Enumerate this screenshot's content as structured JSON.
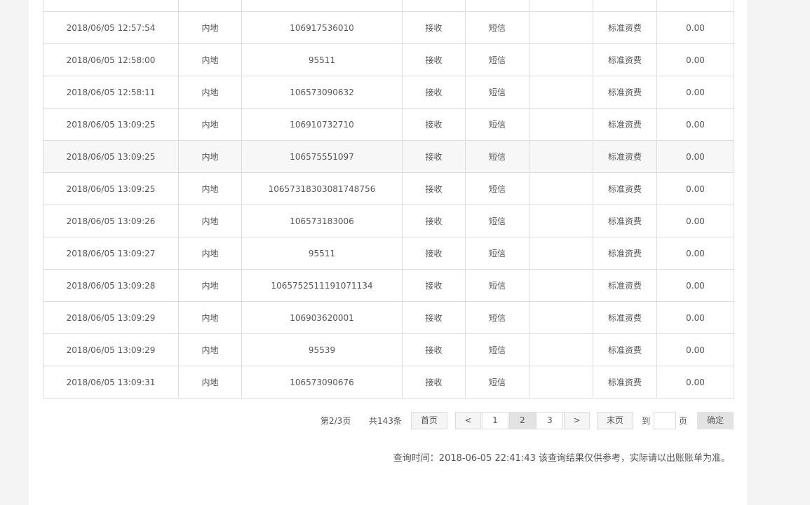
{
  "table": {
    "rows": [
      [
        "",
        "",
        "",
        "",
        "",
        "",
        "",
        ""
      ],
      [
        "2018/06/05 12:57:54",
        "内地",
        "106917536010",
        "接收",
        "短信",
        "",
        "标准资费",
        "0.00"
      ],
      [
        "2018/06/05 12:58:00",
        "内地",
        "95511",
        "接收",
        "短信",
        "",
        "标准资费",
        "0.00"
      ],
      [
        "2018/06/05 12:58:11",
        "内地",
        "106573090632",
        "接收",
        "短信",
        "",
        "标准资费",
        "0.00"
      ],
      [
        "2018/06/05 13:09:25",
        "内地",
        "106910732710",
        "接收",
        "短信",
        "",
        "标准资费",
        "0.00"
      ],
      [
        "2018/06/05 13:09:25",
        "内地",
        "106575551097",
        "接收",
        "短信",
        "",
        "标准资费",
        "0.00"
      ],
      [
        "2018/06/05 13:09:25",
        "内地",
        "10657318303081748756",
        "接收",
        "短信",
        "",
        "标准资费",
        "0.00"
      ],
      [
        "2018/06/05 13:09:26",
        "内地",
        "106573183006",
        "接收",
        "短信",
        "",
        "标准资费",
        "0.00"
      ],
      [
        "2018/06/05 13:09:27",
        "内地",
        "95511",
        "接收",
        "短信",
        "",
        "标准资费",
        "0.00"
      ],
      [
        "2018/06/05 13:09:28",
        "内地",
        "1065752511191071134",
        "接收",
        "短信",
        "",
        "标准资费",
        "0.00"
      ],
      [
        "2018/06/05 13:09:29",
        "内地",
        "106903620001",
        "接收",
        "短信",
        "",
        "标准资费",
        "0.00"
      ],
      [
        "2018/06/05 13:09:29",
        "内地",
        "95539",
        "接收",
        "短信",
        "",
        "标准资费",
        "0.00"
      ],
      [
        "2018/06/05 13:09:31",
        "内地",
        "106573090676",
        "接收",
        "短信",
        "",
        "标准资费",
        "0.00"
      ]
    ],
    "highlighted_row": 5
  },
  "pagination": {
    "page_info": "第2/3页",
    "total_info": "共143条",
    "first_label": "首页",
    "prev_label": "<",
    "pages": [
      "1",
      "2",
      "3"
    ],
    "current_page": "2",
    "next_label": ">",
    "last_label": "末页",
    "goto_prefix": "到",
    "goto_value": "",
    "goto_suffix": "页",
    "confirm_label": "确定"
  },
  "query_note": "查询时间：2018-06-05 22:41:43 该查询结果仅供参考，实际请以出账账单为准。",
  "colors": {
    "page_bg": "#f4f4f4",
    "panel_bg": "#ffffff",
    "border": "#dcdcdc",
    "highlight_row": "#f7f7f7",
    "active_page": "#e3e3e3"
  }
}
